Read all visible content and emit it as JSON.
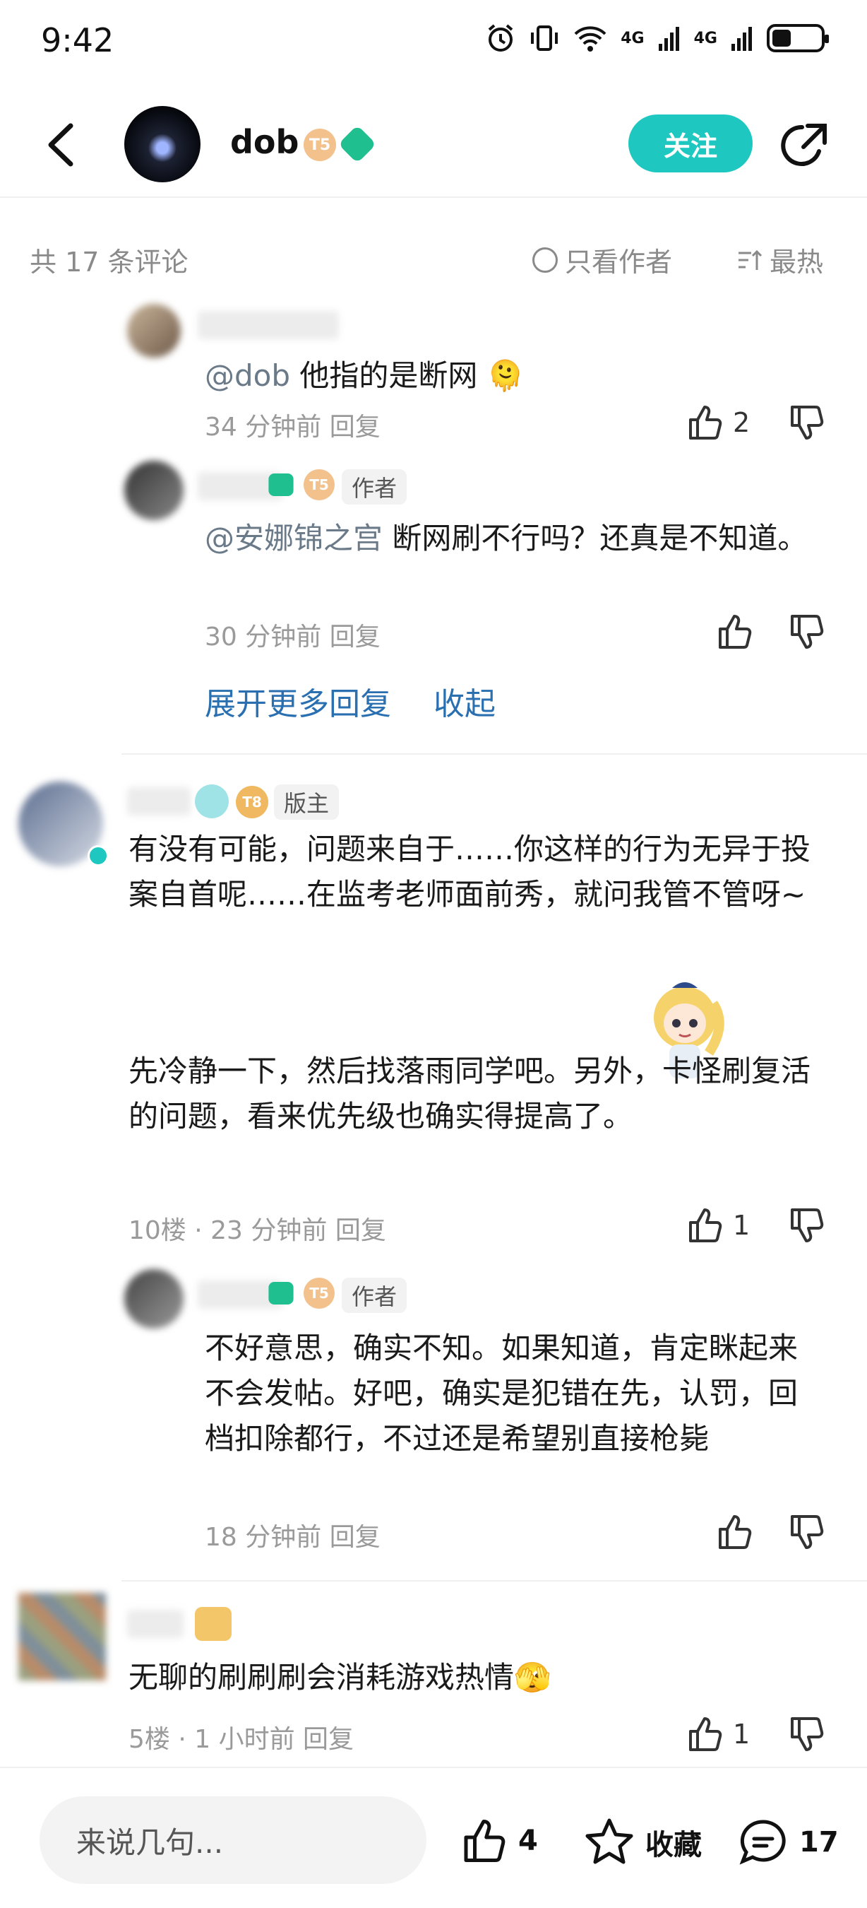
{
  "status_bar": {
    "time": "9:42",
    "network1": "4G",
    "network2": "4G",
    "battery_level": 0.4
  },
  "header": {
    "username": "dob",
    "level_badge": "T5",
    "follow_label": "关注",
    "icons": [
      "back-arrow-icon",
      "share-icon"
    ]
  },
  "filter": {
    "count_label": "共 17 条评论",
    "author_only_label": "只看作者",
    "sort_label": "最热"
  },
  "comments": [
    {
      "text_mention": "@dob",
      "text": "他指的是断网",
      "time": "34 分钟前",
      "reply_label": "回复",
      "likes": "2"
    },
    {
      "author_tag": "作者",
      "level_badge": "T5",
      "text_mention": "@安娜锦之宫",
      "text": "断网刷不行吗？还真是不知道。",
      "time": "30 分钟前",
      "reply_label": "回复"
    },
    {
      "expand_label": "展开更多回复",
      "collapse_label": "收起"
    },
    {
      "role_tag": "版主",
      "level_badge": "T8",
      "paragraph1": "有没有可能，问题来自于……你这样的行为无异于投案自首呢……在监考老师面前秀，就问我管不管呀~",
      "paragraph2": "先冷静一下，然后找落雨同学吧。另外，卡怪刷复活的问题，看来优先级也确实得提高了。",
      "floor": "10楼 · 23 分钟前",
      "reply_label": "回复",
      "likes": "1"
    },
    {
      "author_tag": "作者",
      "level_badge": "T5",
      "text": "不好意思，确实不知。如果知道，肯定眯起来不会发帖。好吧，确实是犯错在先，认罚，回档扣除都行，不过还是希望别直接枪毙",
      "time": "18 分钟前",
      "reply_label": "回复"
    },
    {
      "text": "无聊的刷刷刷会消耗游戏热情",
      "floor": "5楼 · 1 小时前",
      "reply_label": "回复",
      "likes": "1"
    }
  ],
  "bottom_bar": {
    "input_placeholder": "来说几句...",
    "likes": "4",
    "favorite_label": "收藏",
    "comments": "17"
  },
  "colors": {
    "accent": "#1ec8c0",
    "link": "#2a6fb0",
    "meta": "#9a9a9a"
  }
}
